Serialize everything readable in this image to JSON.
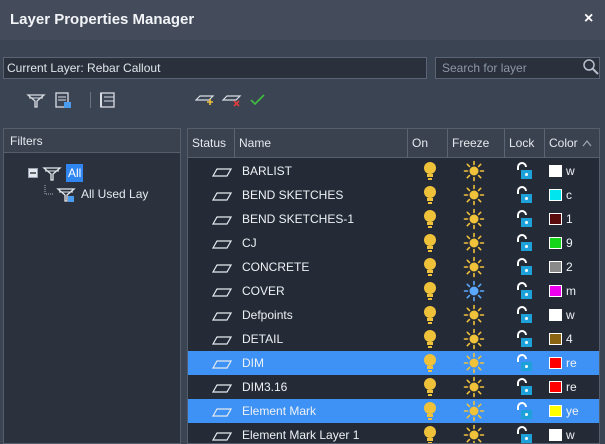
{
  "window": {
    "title": "Layer Properties Manager",
    "close_label": "×"
  },
  "current_layer": {
    "text": "Current Layer: Rebar Callout"
  },
  "search": {
    "placeholder": "Search for layer"
  },
  "filters": {
    "header": "Filters",
    "tree": [
      {
        "label": "All"
      },
      {
        "label": "All Used Lay"
      }
    ]
  },
  "grid": {
    "columns": {
      "status": "Status",
      "name": "Name",
      "on": "On",
      "freeze": "Freeze",
      "lock": "Lock",
      "color": "Color"
    },
    "layers": [
      {
        "name": "BARLIST",
        "color_name": "w",
        "color": "#ffffff",
        "frozen": false,
        "selected": false
      },
      {
        "name": "BEND SKETCHES",
        "color_name": "c",
        "color": "#00e5ee",
        "frozen": false,
        "selected": false
      },
      {
        "name": "BEND SKETCHES-1",
        "color_name": "1",
        "color": "#5a0b0b",
        "frozen": false,
        "selected": false
      },
      {
        "name": "CJ",
        "color_name": "9",
        "color": "#16d61a",
        "frozen": false,
        "selected": false
      },
      {
        "name": "CONCRETE",
        "color_name": "2",
        "color": "#8a8a8a",
        "frozen": false,
        "selected": false
      },
      {
        "name": "COVER",
        "color_name": "m",
        "color": "#ee00ee",
        "frozen": true,
        "selected": false
      },
      {
        "name": "Defpoints",
        "color_name": "w",
        "color": "#ffffff",
        "frozen": false,
        "selected": false
      },
      {
        "name": "DETAIL",
        "color_name": "4",
        "color": "#8a6410",
        "frozen": false,
        "selected": false
      },
      {
        "name": "DIM",
        "color_name": "re",
        "color": "#ff0000",
        "frozen": false,
        "selected": true
      },
      {
        "name": "DIM3.16",
        "color_name": "re",
        "color": "#ff0000",
        "frozen": false,
        "selected": false
      },
      {
        "name": "Element Mark",
        "color_name": "ye",
        "color": "#ffff00",
        "frozen": false,
        "selected": true
      },
      {
        "name": "Element Mark Layer 1",
        "color_name": "w",
        "color": "#ffffff",
        "frozen": false,
        "selected": false
      }
    ]
  }
}
